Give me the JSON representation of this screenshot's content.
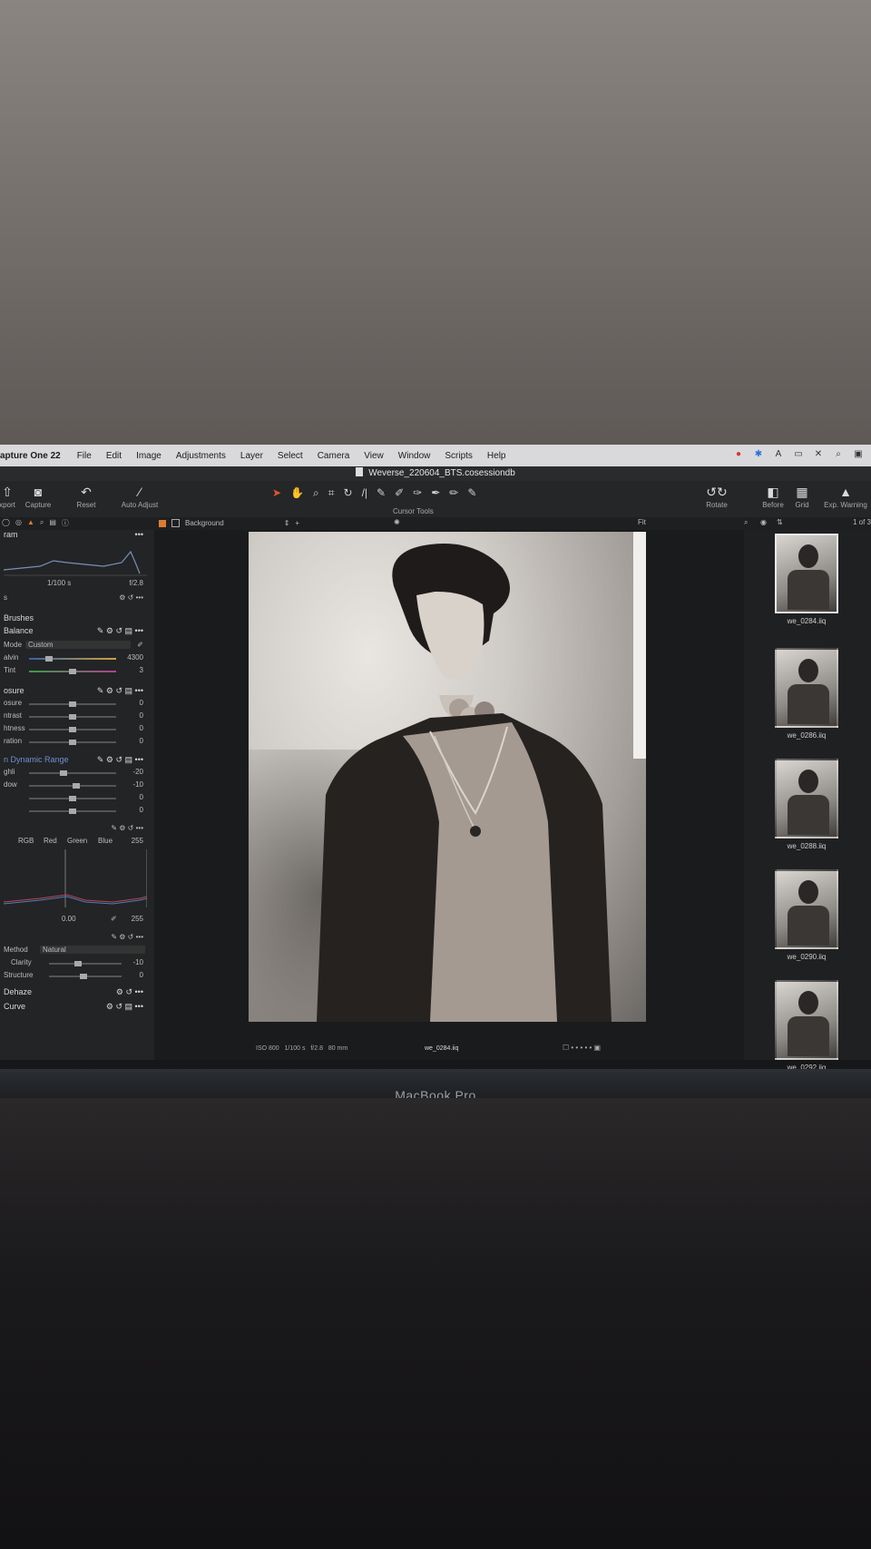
{
  "menubar": {
    "app": "apture One 22",
    "items": [
      "File",
      "Edit",
      "Image",
      "Adjustments",
      "Layer",
      "Select",
      "Camera",
      "View",
      "Window",
      "Scripts",
      "Help"
    ]
  },
  "window_title": "Weverse_220604_BTS.cosessiondb",
  "toolbar": {
    "left": [
      {
        "label": "xport",
        "icon": "export-icon"
      },
      {
        "label": "Capture",
        "icon": "camera-icon"
      },
      {
        "label": "Reset",
        "icon": "reset-icon"
      },
      {
        "label": "Auto Adjust",
        "icon": "wand-icon"
      }
    ],
    "cursor_tools_label": "Cursor Tools",
    "rotate_label": "Rotate",
    "right": [
      {
        "label": "Before",
        "icon": "before-icon"
      },
      {
        "label": "Grid",
        "icon": "grid-icon"
      },
      {
        "label": "Exp. Warning",
        "icon": "warning-icon"
      }
    ]
  },
  "subbar": {
    "layer": "Background",
    "fit": "Fit",
    "count": "1 of 3"
  },
  "left_panel": {
    "histogram_title": "ram",
    "shutter": "1/100 s",
    "aperture": "f/2.8",
    "brushes": "Brushes",
    "white_balance": "Balance",
    "mode_label": "Mode",
    "mode_value": "Custom",
    "kelvin_label": "alvin",
    "kelvin_value": "4300",
    "tint_label": "Tint",
    "tint_value": "3",
    "exposure_title": "osure",
    "exposure_rows": [
      {
        "label": "osure",
        "value": "0"
      },
      {
        "label": "ntrast",
        "value": "0"
      },
      {
        "label": "htness",
        "value": "0"
      },
      {
        "label": "ration",
        "value": "0"
      }
    ],
    "hdr_title": "n Dynamic Range",
    "hdr_rows": [
      {
        "label": "ghli",
        "value": "-20"
      },
      {
        "label": "dow",
        "value": "-10"
      },
      {
        "label": "",
        "value": "0"
      },
      {
        "label": "",
        "value": "0"
      }
    ],
    "levels_tabs": [
      "RGB",
      "Red",
      "Green",
      "Blue"
    ],
    "levels_max": "255",
    "levels_low": "0.00",
    "levels_high": "255",
    "method_label": "Method",
    "method_value": "Natural",
    "clarity_label": "Clarity",
    "clarity_value": "-10",
    "structure_label": "Structure",
    "structure_value": "0",
    "dehaze": "Dehaze",
    "curve": "Curve"
  },
  "viewer": {
    "iso": "ISO 800",
    "shutter": "1/100 s",
    "aperture": "f/2.8",
    "focal": "80 mm",
    "filename": "we_0284.iiq"
  },
  "filmstrip": [
    {
      "name": "we_0284.iiq",
      "selected": true
    },
    {
      "name": "we_0286.iiq",
      "selected": false
    },
    {
      "name": "we_0288.iiq",
      "selected": false
    },
    {
      "name": "we_0290.iiq",
      "selected": false
    },
    {
      "name": "we_0292.iiq",
      "selected": false
    }
  ],
  "bezel_label": "MacBook Pro"
}
